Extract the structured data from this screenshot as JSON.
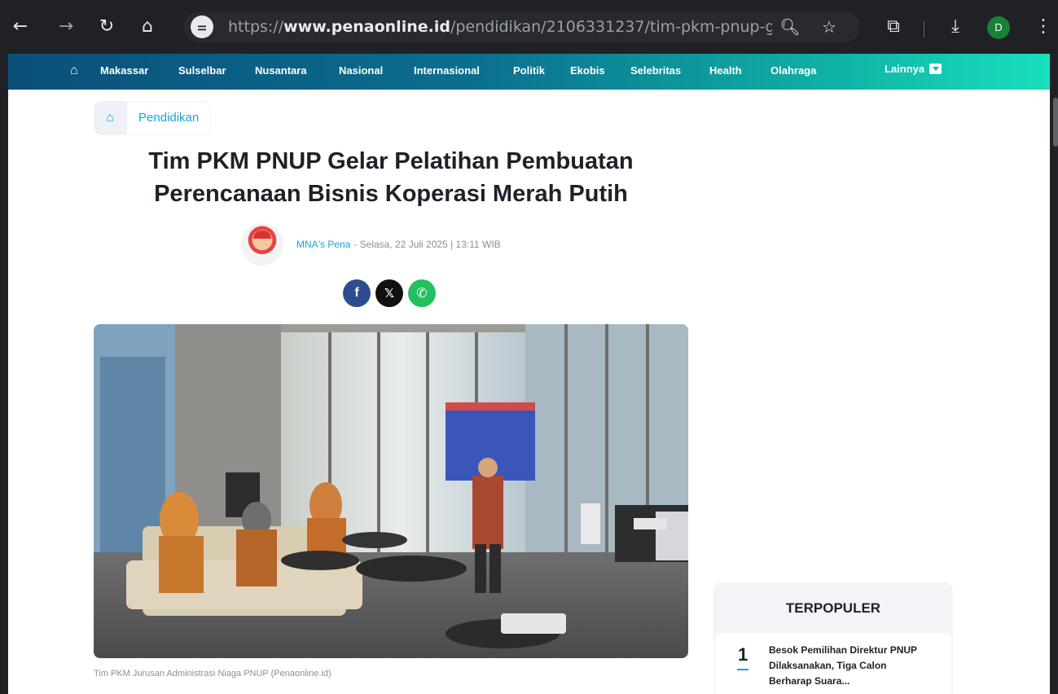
{
  "browser": {
    "url_prefix": "https://",
    "url_domain": "www.penaonline.id",
    "url_path": "/pendidikan/2106331237/tim-pkm-pnup-ge...",
    "profile_initial": "D",
    "icons": [
      "back-icon",
      "forward-icon",
      "reload-icon",
      "home-icon",
      "site-info-icon",
      "zoom-icon",
      "bookmark-star-icon",
      "extensions-icon",
      "download-icon",
      "menu-kebab-icon"
    ]
  },
  "nav": {
    "items": [
      "Makassar",
      "Sulselbar",
      "Nusantara",
      "Nasional",
      "Internasional",
      "Politik",
      "Ekobis",
      "Selebritas",
      "Health",
      "Olahraga"
    ],
    "more_label": "Lainnya"
  },
  "colors": {
    "accent": "#16a5dc",
    "nav_start": "#0a4f7a",
    "nav_end": "#19e0bd",
    "chrome_bg": "#202124"
  },
  "article": {
    "breadcrumb": "Pendidikan",
    "title": "Tim PKM PNUP Gelar Pelatihan Pembuatan Perencanaan Bisnis Koperasi Merah Putih",
    "author": "MNA's Pena",
    "date": "- Selasa, 22 Juli 2025 | 13:11 WIB",
    "share": [
      "facebook",
      "x",
      "whatsapp"
    ],
    "caption": "Tim PKM Jurusan Administrasi Niaga PNUP (Penaonline.id)"
  },
  "sidebar": {
    "popular_title": "TERPOPULER",
    "popular_items": [
      {
        "rank": "1",
        "text": "Besok Pemilihan Direktur PNUP Dilaksanakan, Tiga Calon Berharap Suara..."
      }
    ]
  }
}
